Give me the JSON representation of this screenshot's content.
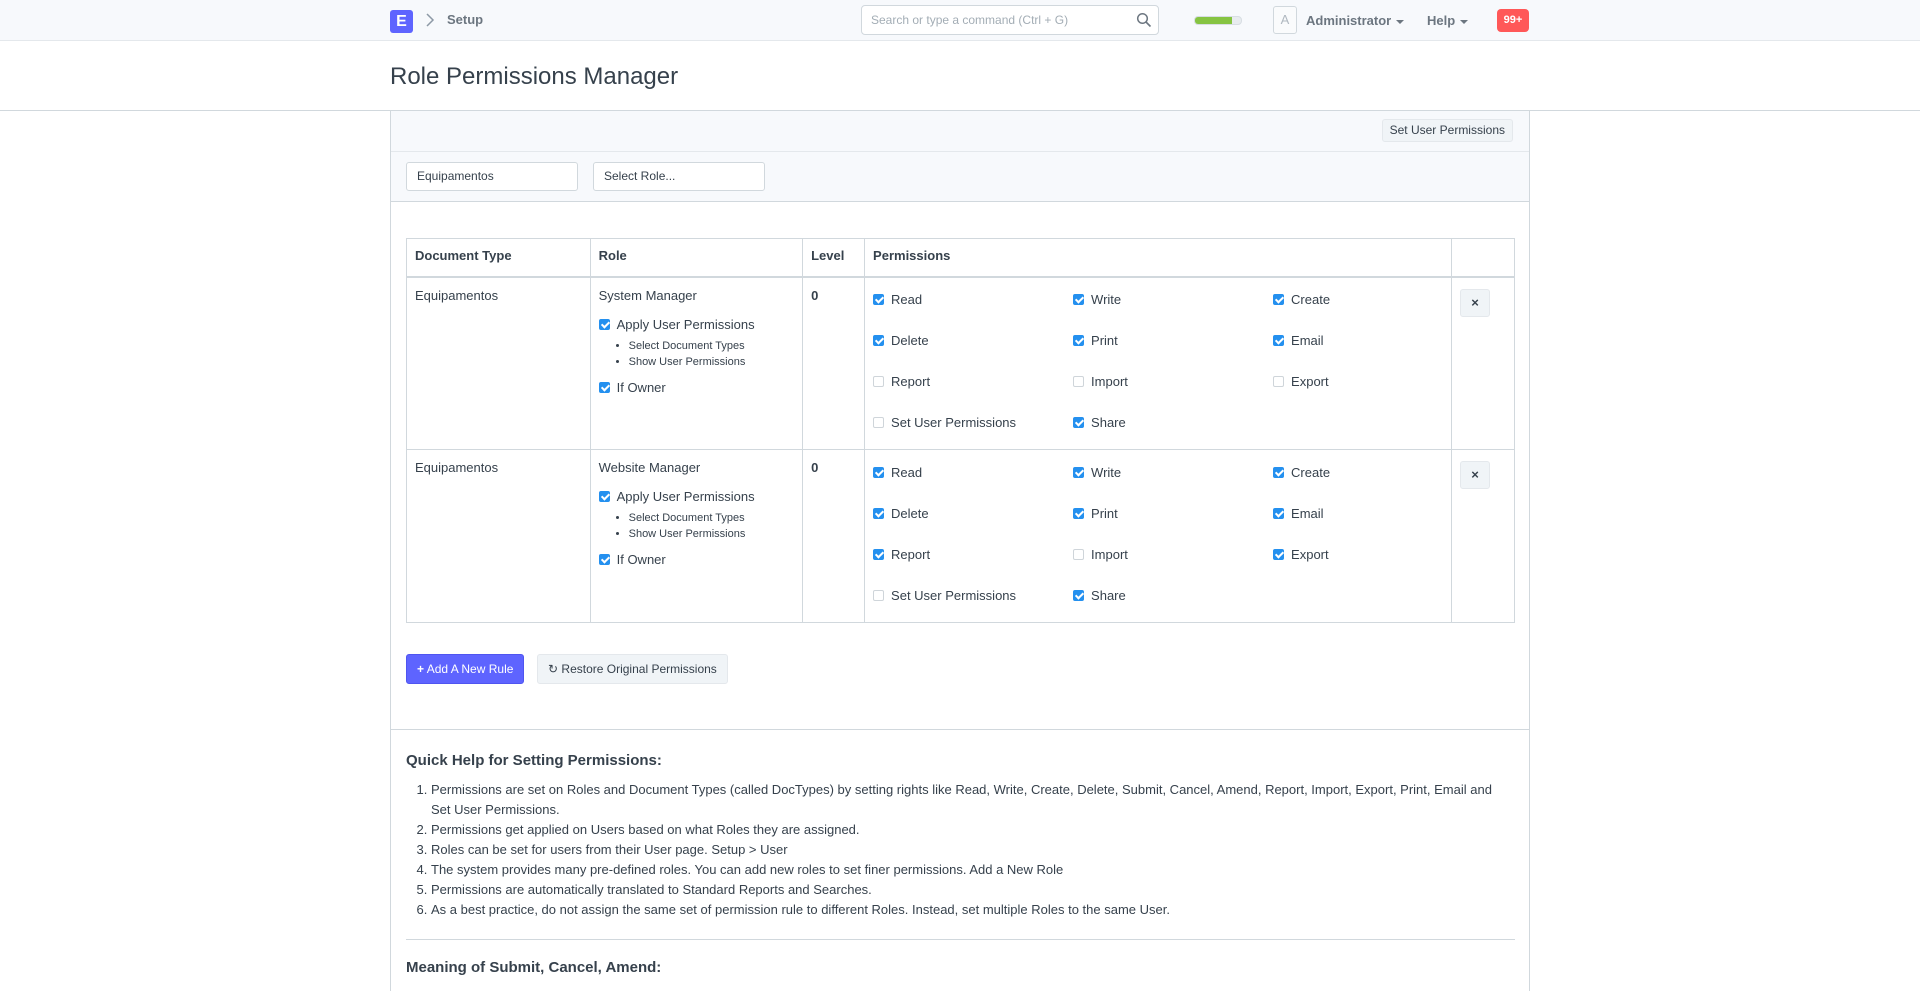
{
  "navbar": {
    "logo_letter": "E",
    "breadcrumb": "Setup",
    "search_placeholder": "Search or type a command (Ctrl + G)",
    "progress_fraction": 0.8,
    "avatar_letter": "A",
    "user_label": "Administrator",
    "help_label": "Help",
    "notification_count": "99+"
  },
  "page": {
    "title": "Role Permissions Manager"
  },
  "toolbar": {
    "set_user_permissions": "Set User Permissions"
  },
  "filters": {
    "doctype": "Equipamentos",
    "role_placeholder": "Select Role..."
  },
  "table": {
    "headers": [
      "Document Type",
      "Role",
      "Level",
      "Permissions",
      ""
    ],
    "rows": [
      {
        "doctype": "Equipamentos",
        "role": "System Manager",
        "apply_user_permissions": "Apply User Permissions",
        "apply_checked": true,
        "sub_items": [
          "Select Document Types",
          "Show User Permissions"
        ],
        "if_owner": "If Owner",
        "if_owner_checked": true,
        "level": "0",
        "permissions": [
          {
            "label": "Read",
            "checked": true
          },
          {
            "label": "Write",
            "checked": true
          },
          {
            "label": "Create",
            "checked": true
          },
          {
            "label": "Delete",
            "checked": true
          },
          {
            "label": "Print",
            "checked": true
          },
          {
            "label": "Email",
            "checked": true
          },
          {
            "label": "Report",
            "checked": false
          },
          {
            "label": "Import",
            "checked": false
          },
          {
            "label": "Export",
            "checked": false
          },
          {
            "label": "Set User Permissions",
            "checked": false
          },
          {
            "label": "Share",
            "checked": true
          }
        ],
        "delete_label": "×"
      },
      {
        "doctype": "Equipamentos",
        "role": "Website Manager",
        "apply_user_permissions": "Apply User Permissions",
        "apply_checked": true,
        "sub_items": [
          "Select Document Types",
          "Show User Permissions"
        ],
        "if_owner": "If Owner",
        "if_owner_checked": true,
        "level": "0",
        "permissions": [
          {
            "label": "Read",
            "checked": true
          },
          {
            "label": "Write",
            "checked": true
          },
          {
            "label": "Create",
            "checked": true
          },
          {
            "label": "Delete",
            "checked": true
          },
          {
            "label": "Print",
            "checked": true
          },
          {
            "label": "Email",
            "checked": true
          },
          {
            "label": "Report",
            "checked": true
          },
          {
            "label": "Import",
            "checked": false
          },
          {
            "label": "Export",
            "checked": true
          },
          {
            "label": "Set User Permissions",
            "checked": false
          },
          {
            "label": "Share",
            "checked": true
          }
        ],
        "delete_label": "×"
      }
    ]
  },
  "actions": {
    "add_rule": "Add A New Rule",
    "restore": "Restore Original Permissions"
  },
  "help": {
    "title": "Quick Help for Setting Permissions:",
    "items": [
      "Permissions are set on Roles and Document Types (called DocTypes) by setting rights like Read, Write, Create, Delete, Submit, Cancel, Amend, Report, Import, Export, Print, Email and Set User Permissions.",
      "Permissions get applied on Users based on what Roles they are assigned.",
      "Roles can be set for users from their User page. Setup > User",
      "The system provides many pre-defined roles. You can add new roles to set finer permissions. Add a New Role",
      "Permissions are automatically translated to Standard Reports and Searches.",
      "As a best practice, do not assign the same set of permission rule to different Roles. Instead, set multiple Roles to the same User."
    ],
    "title2": "Meaning of Submit, Cancel, Amend:"
  },
  "colors": {
    "primary": "#5e64ff",
    "checkbox": "#2490ef",
    "notification": "#ff5858",
    "progress": "#86c442"
  }
}
